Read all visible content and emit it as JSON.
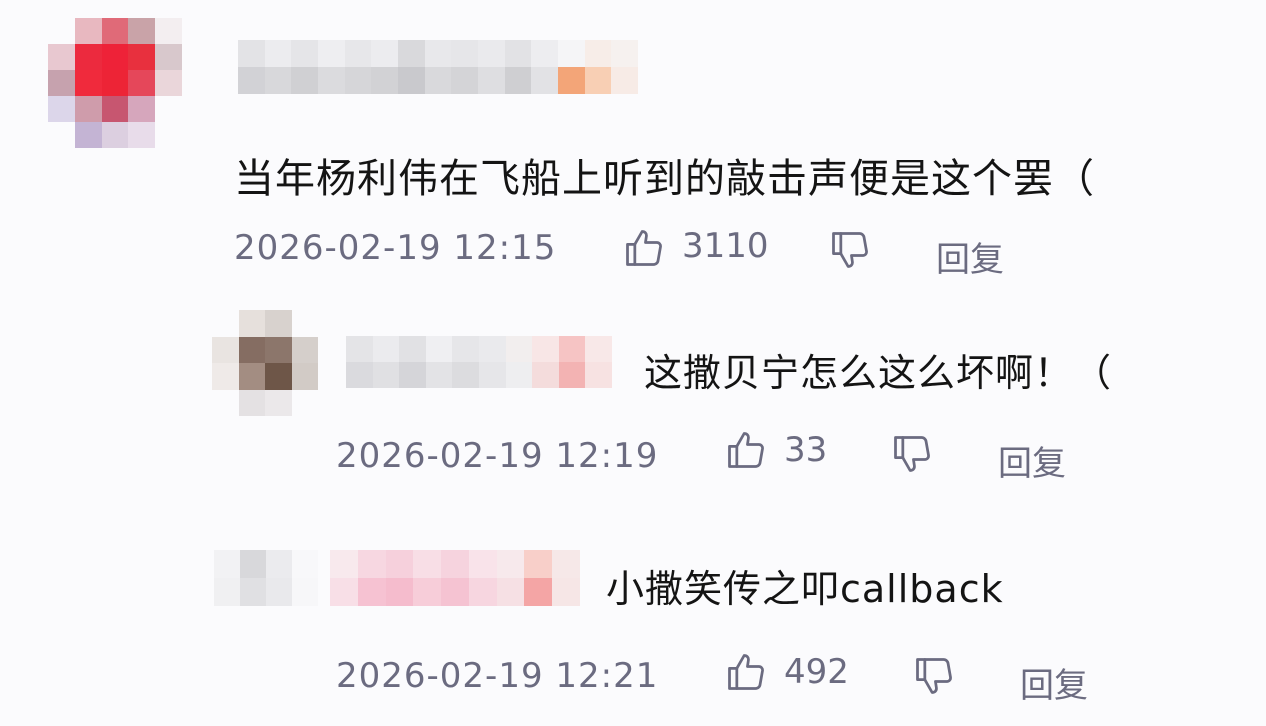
{
  "comments": [
    {
      "text": "当年杨利伟在飞船上听到的敲击声便是这个罢（",
      "timestamp": "2026-02-19 12:15",
      "likes": "3110",
      "reply_label": "回复"
    }
  ],
  "replies": [
    {
      "text": "这撒贝宁怎么这么坏啊！（",
      "timestamp": "2026-02-19 12:19",
      "likes": "33",
      "reply_label": "回复"
    },
    {
      "text": "小撒笑传之叩callback",
      "timestamp": "2026-02-19 12:21",
      "likes": "492",
      "reply_label": "回复"
    }
  ],
  "icons": {
    "like": "thumbs-up-icon",
    "dislike": "thumbs-down-icon"
  },
  "colors": {
    "meta_text": "#6b6b80",
    "body_text": "#141414",
    "background": "#fbfbfd"
  }
}
